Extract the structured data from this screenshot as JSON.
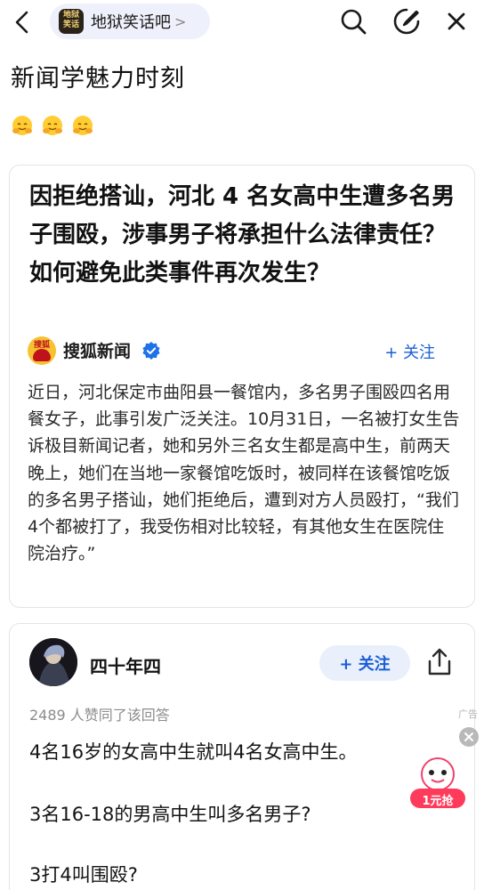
{
  "topbar": {
    "forum_name": "地狱笑话吧",
    "forum_avatar_text": "地狱\n笑话",
    "chevron": ">"
  },
  "post": {
    "title": "新闻学魅力时刻",
    "emoji_count": 3
  },
  "shared_article": {
    "title": "因拒绝搭讪，河北 4 名女高中生遭多名男子围殴，涉事男子将承担什么法律责任？如何避免此类事件再次发生？",
    "source_name": "搜狐新闻",
    "source_logo_text": "搜狐",
    "follow_label": "+ 关注",
    "body": "近日，河北保定市曲阳县一餐馆内，多名男子围殴四名用餐女子，此事引发广泛关注。10月31日，一名被打女生告诉极目新闻记者，她和另外三名女生都是高中生，前两天晚上，她们在当地一家餐馆吃饭时，被同样在该餐馆吃饭的多名男子搭讪，她们拒绝后，遭到对方人员殴打，“我们4个都被打了，我受伤相对比较轻，有其他女生在医院住院治疗。”"
  },
  "answer": {
    "user_name": "四十年四",
    "follow_label": "+ 关注",
    "likes_text": "2489 人赞同了该回答",
    "lines": [
      "4名16岁的女高中生就叫4名女高中生。",
      "3名16-18的男高中生叫多名男子?",
      "3打4叫围殴?"
    ]
  },
  "ad": {
    "label": "广告",
    "promo_text": "1元抢"
  },
  "colors": {
    "accent": "#1a5ed8",
    "muted": "#8c8c8c",
    "pill_bg": "#eef0fb"
  },
  "icons": [
    "back-arrow-icon",
    "search-icon",
    "compose-icon",
    "verified-icon",
    "share-icon",
    "close-icon",
    "emoji-hug-icon"
  ]
}
